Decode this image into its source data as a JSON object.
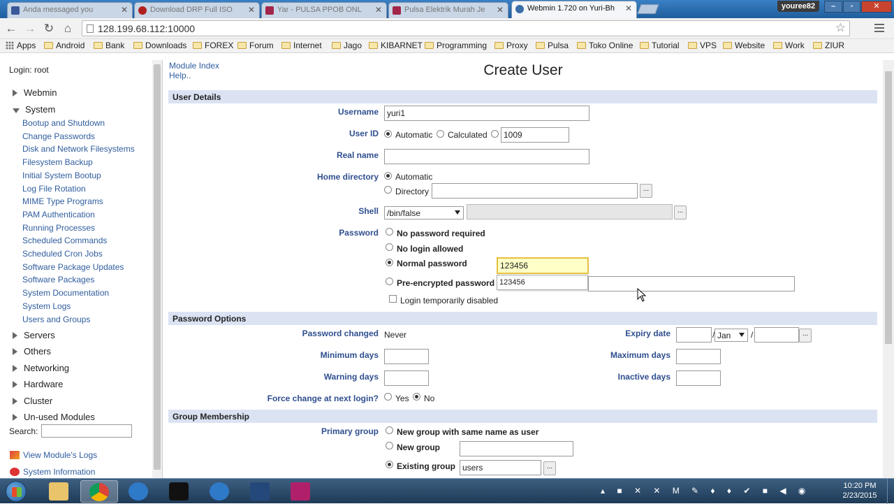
{
  "browser": {
    "tabs": [
      {
        "label": "Anda messaged you"
      },
      {
        "label": "Download DRP Full ISO"
      },
      {
        "label": "Yar - PULSA PPOB ONL"
      },
      {
        "label": "Pulsa Elektrik Murah Je"
      },
      {
        "label": "Webmin 1.720 on Yuri-Bh"
      }
    ],
    "user_badge": "youree82",
    "url": "128.199.68.112:10000",
    "bookmarks": [
      "Apps",
      "Android",
      "Bank",
      "Downloads",
      "FOREX",
      "Forum",
      "Internet",
      "Jago",
      "KIBARNET",
      "Programming",
      "Proxy",
      "Pulsa",
      "Toko Online",
      "Tutorial",
      "VPS",
      "Website",
      "Work",
      "ZIUR"
    ]
  },
  "left": {
    "login": "Login: root",
    "categories": [
      "Webmin",
      "System",
      "Servers",
      "Others",
      "Networking",
      "Hardware",
      "Cluster",
      "Un-used Modules"
    ],
    "system_modules": [
      "Bootup and Shutdown",
      "Change Passwords",
      "Disk and Network Filesystems",
      "Filesystem Backup",
      "Initial System Bootup",
      "Log File Rotation",
      "MIME Type Programs",
      "PAM Authentication",
      "Running Processes",
      "Scheduled Commands",
      "Scheduled Cron Jobs",
      "Software Package Updates",
      "Software Packages",
      "System Documentation",
      "System Logs",
      "Users and Groups"
    ],
    "search_label": "Search:",
    "view_logs": "View Module's Logs",
    "system_info": "System Information"
  },
  "page": {
    "module_index": "Module Index",
    "help": "Help..",
    "title": "Create User",
    "user_details": {
      "section": "User Details",
      "username_label": "Username",
      "username_value": "yuri1",
      "userid_label": "User ID",
      "automatic": "Automatic",
      "calculated": "Calculated",
      "userid_value": "1009",
      "realname_label": "Real name",
      "homedir_label": "Home directory",
      "home_automatic": "Automatic",
      "home_directory": "Directory",
      "shell_label": "Shell",
      "shell_value": "/bin/false",
      "password_label": "Password",
      "no_password": "No password required",
      "no_login": "No login allowed",
      "normal_password": "Normal password",
      "normal_password_value": "123456",
      "autocomplete_suggestion": "123456",
      "pre_encrypted": "Pre-encrypted password",
      "login_disabled": "Login temporarily disabled"
    },
    "password_options": {
      "section": "Password Options",
      "changed_label": "Password changed",
      "changed_value": "Never",
      "expiry_label": "Expiry date",
      "expiry_month": "Jan",
      "min_days": "Minimum days",
      "max_days": "Maximum days",
      "warning_days": "Warning days",
      "inactive_days": "Inactive days",
      "force_change": "Force change at next login?",
      "yes": "Yes",
      "no": "No"
    },
    "group_membership": {
      "section": "Group Membership",
      "primary_label": "Primary group",
      "new_same": "New group with same name as user",
      "new_group": "New group",
      "existing_group": "Existing group",
      "existing_value": "users"
    }
  },
  "taskbar": {
    "time": "10:20 PM",
    "date": "2/23/2015"
  }
}
